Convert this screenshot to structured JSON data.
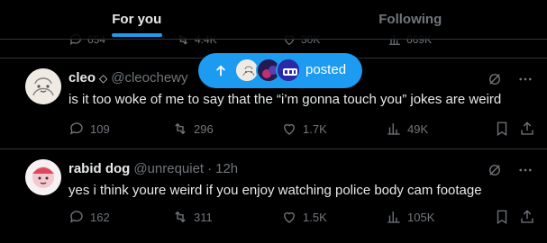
{
  "tabs": [
    {
      "label": "For you",
      "active": true
    },
    {
      "label": "Following",
      "active": false
    }
  ],
  "prev_actions": {
    "replies": "654",
    "reposts": "4.4K",
    "likes": "30K",
    "views": "669K"
  },
  "pill": {
    "label": "posted"
  },
  "tweets": [
    {
      "name": "cleo",
      "verified_icon": "diamond-icon",
      "handle": "@cleochewy",
      "time": "",
      "text": "is it too woke of me to say that the “i’m gonna touch you” jokes are weird",
      "replies": "109",
      "reposts": "296",
      "likes": "1.7K",
      "views": "49K"
    },
    {
      "name": "rabid dog",
      "handle": "@unrequiet",
      "time": "12h",
      "text": "yes i think youre weird if you enjoy watching police body cam footage",
      "replies": "162",
      "reposts": "311",
      "likes": "1.5K",
      "views": "105K"
    }
  ],
  "colors": {
    "accent": "#1d9bf0",
    "muted": "#71767b",
    "text": "#e7e9ea",
    "border": "#2f3336"
  }
}
